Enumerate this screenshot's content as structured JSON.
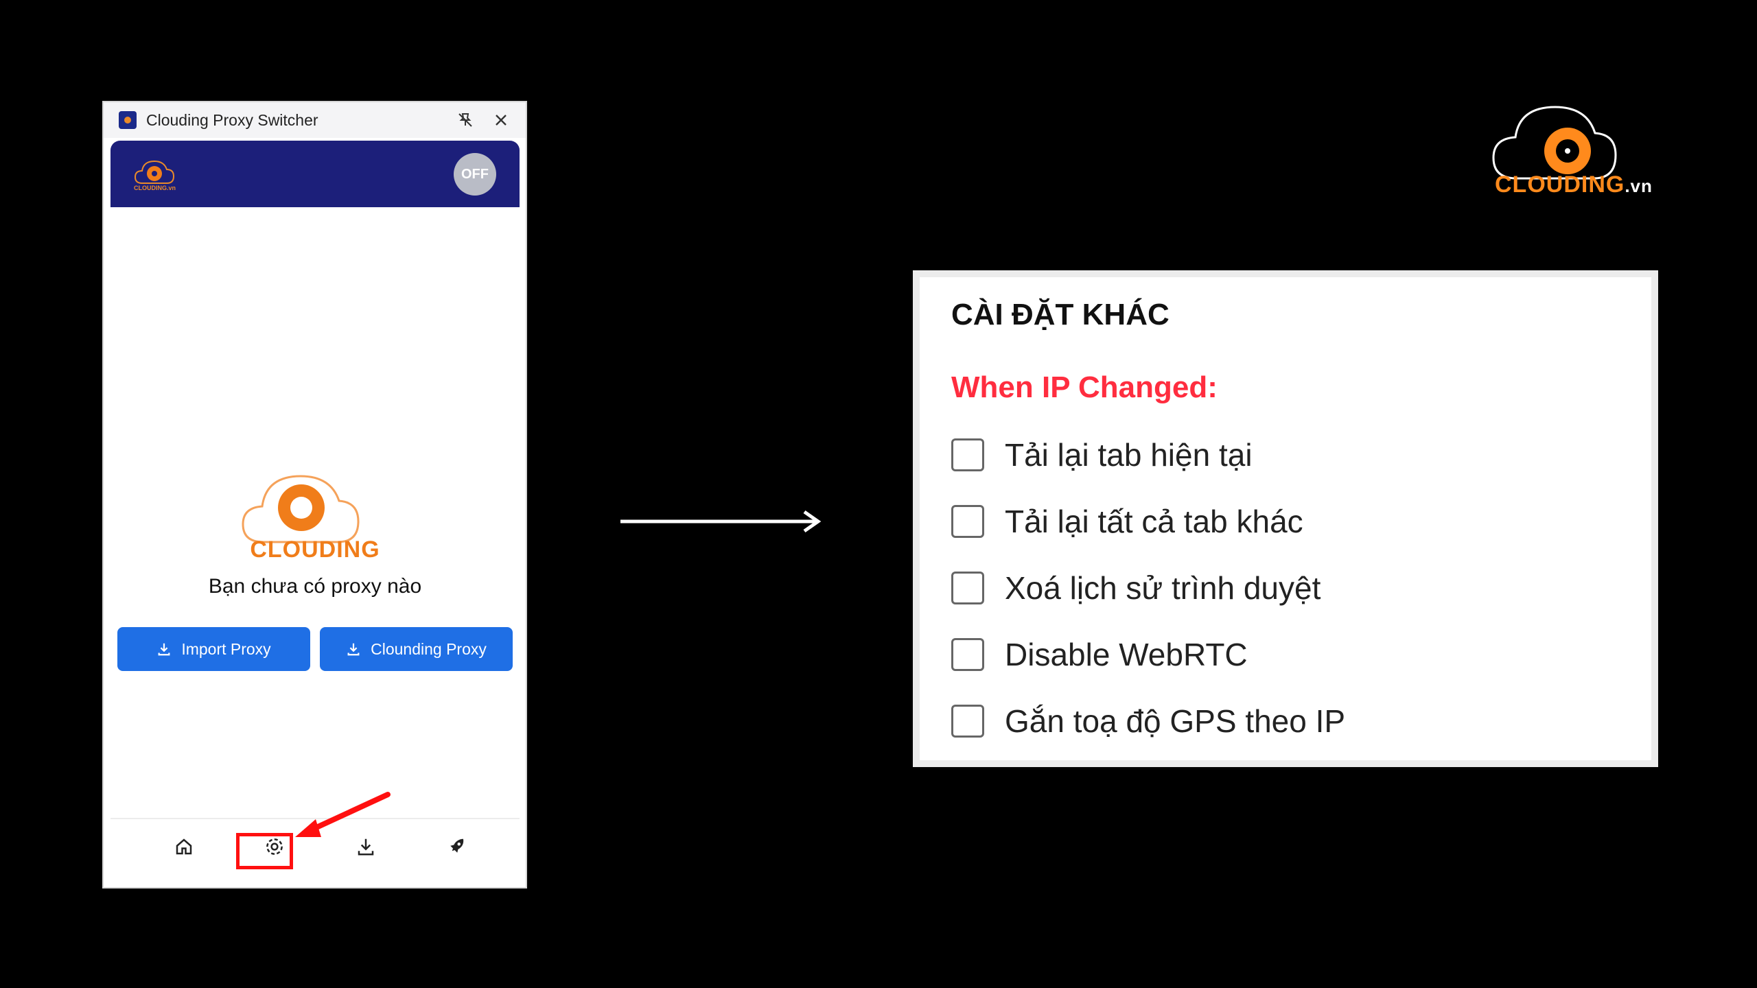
{
  "popup": {
    "title": "Clouding Proxy Switcher",
    "toggle_label": "OFF",
    "empty_message": "Bạn chưa có proxy nào",
    "logo_text": "CLOUDING",
    "header_logo_text": "CLOUDING.vn",
    "buttons": {
      "import": "Import Proxy",
      "clouding": "Clounding Proxy"
    },
    "nav": [
      "home-icon",
      "settings-icon",
      "download-icon",
      "rocket-icon"
    ],
    "colors": {
      "header": "#1c1f7a",
      "button": "#1f6fe5",
      "highlight": "#ff1010"
    }
  },
  "brand": {
    "name": "CLOUDING",
    "suffix": ".vn",
    "accent": "#ff8a1c"
  },
  "settings": {
    "title": "CÀI ĐẶT KHÁC",
    "section": "When IP Changed:",
    "options": [
      {
        "label": "Tải lại tab hiện tại",
        "checked": false
      },
      {
        "label": "Tải lại tất cả tab khác",
        "checked": false
      },
      {
        "label": "Xoá lịch sử trình duyệt",
        "checked": false
      },
      {
        "label": "Disable WebRTC",
        "checked": false
      },
      {
        "label": "Gắn toạ độ GPS theo IP",
        "checked": false
      }
    ],
    "section_color": "#ff2d3f"
  }
}
